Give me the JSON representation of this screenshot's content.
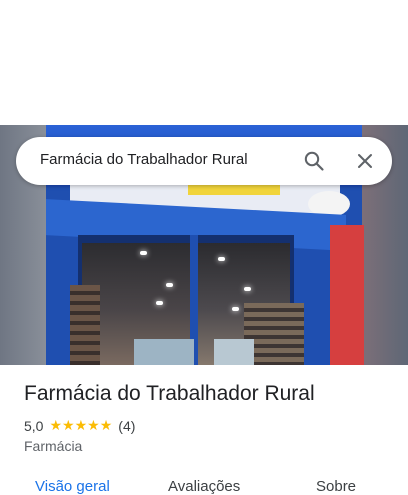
{
  "search": {
    "query": "Farmácia do Trabalhador Rural",
    "search_icon": "search-icon",
    "close_icon": "close-icon"
  },
  "place": {
    "name": "Farmácia do Trabalhador Rural",
    "rating": "5,0",
    "stars": 5,
    "reviews_count": "(4)",
    "category": "Farmácia"
  },
  "tabs": [
    {
      "label": "Visão geral",
      "selected": true
    },
    {
      "label": "Avaliações",
      "selected": false
    },
    {
      "label": "Sobre",
      "selected": false
    }
  ],
  "colors": {
    "accent": "#1a73e8",
    "star": "#fbbc04",
    "text": "#202124"
  }
}
